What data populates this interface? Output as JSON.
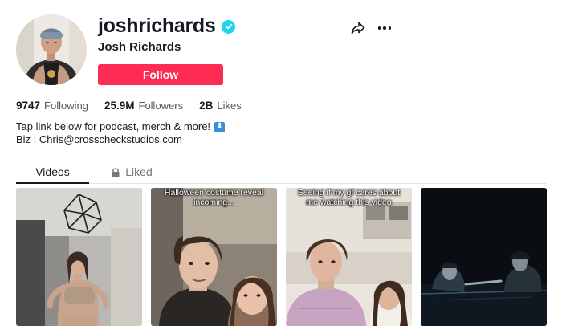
{
  "profile": {
    "username": "joshrichards",
    "display_name": "Josh Richards",
    "verified": true,
    "follow_label": "Follow"
  },
  "icons": {
    "share": "share-arrow-icon",
    "more": "more-horizontal-icon",
    "verified": "verified-badge-icon",
    "lock": "lock-icon"
  },
  "stats": [
    {
      "value": "9747",
      "label": "Following"
    },
    {
      "value": "25.9M",
      "label": "Followers"
    },
    {
      "value": "2B",
      "label": "Likes"
    }
  ],
  "bio": {
    "line1": "Tap link below for podcast, merch & more!",
    "line1_emoji": "⬇",
    "line2": "Biz : Chris@crosscheckstudios.com"
  },
  "tabs": [
    {
      "label": "Videos",
      "active": true
    },
    {
      "label": "Liked",
      "active": false,
      "locked": true
    }
  ],
  "videos": [
    {
      "caption": ""
    },
    {
      "caption": "Halloween costume reveal incoming..."
    },
    {
      "caption": "Seeing if my gf cares about me watching this video"
    },
    {
      "caption": ""
    }
  ],
  "colors": {
    "follow_button": "#fe2c55",
    "verified_badge": "#20d5ec",
    "text_primary": "#161823",
    "text_secondary": "#57585f"
  }
}
